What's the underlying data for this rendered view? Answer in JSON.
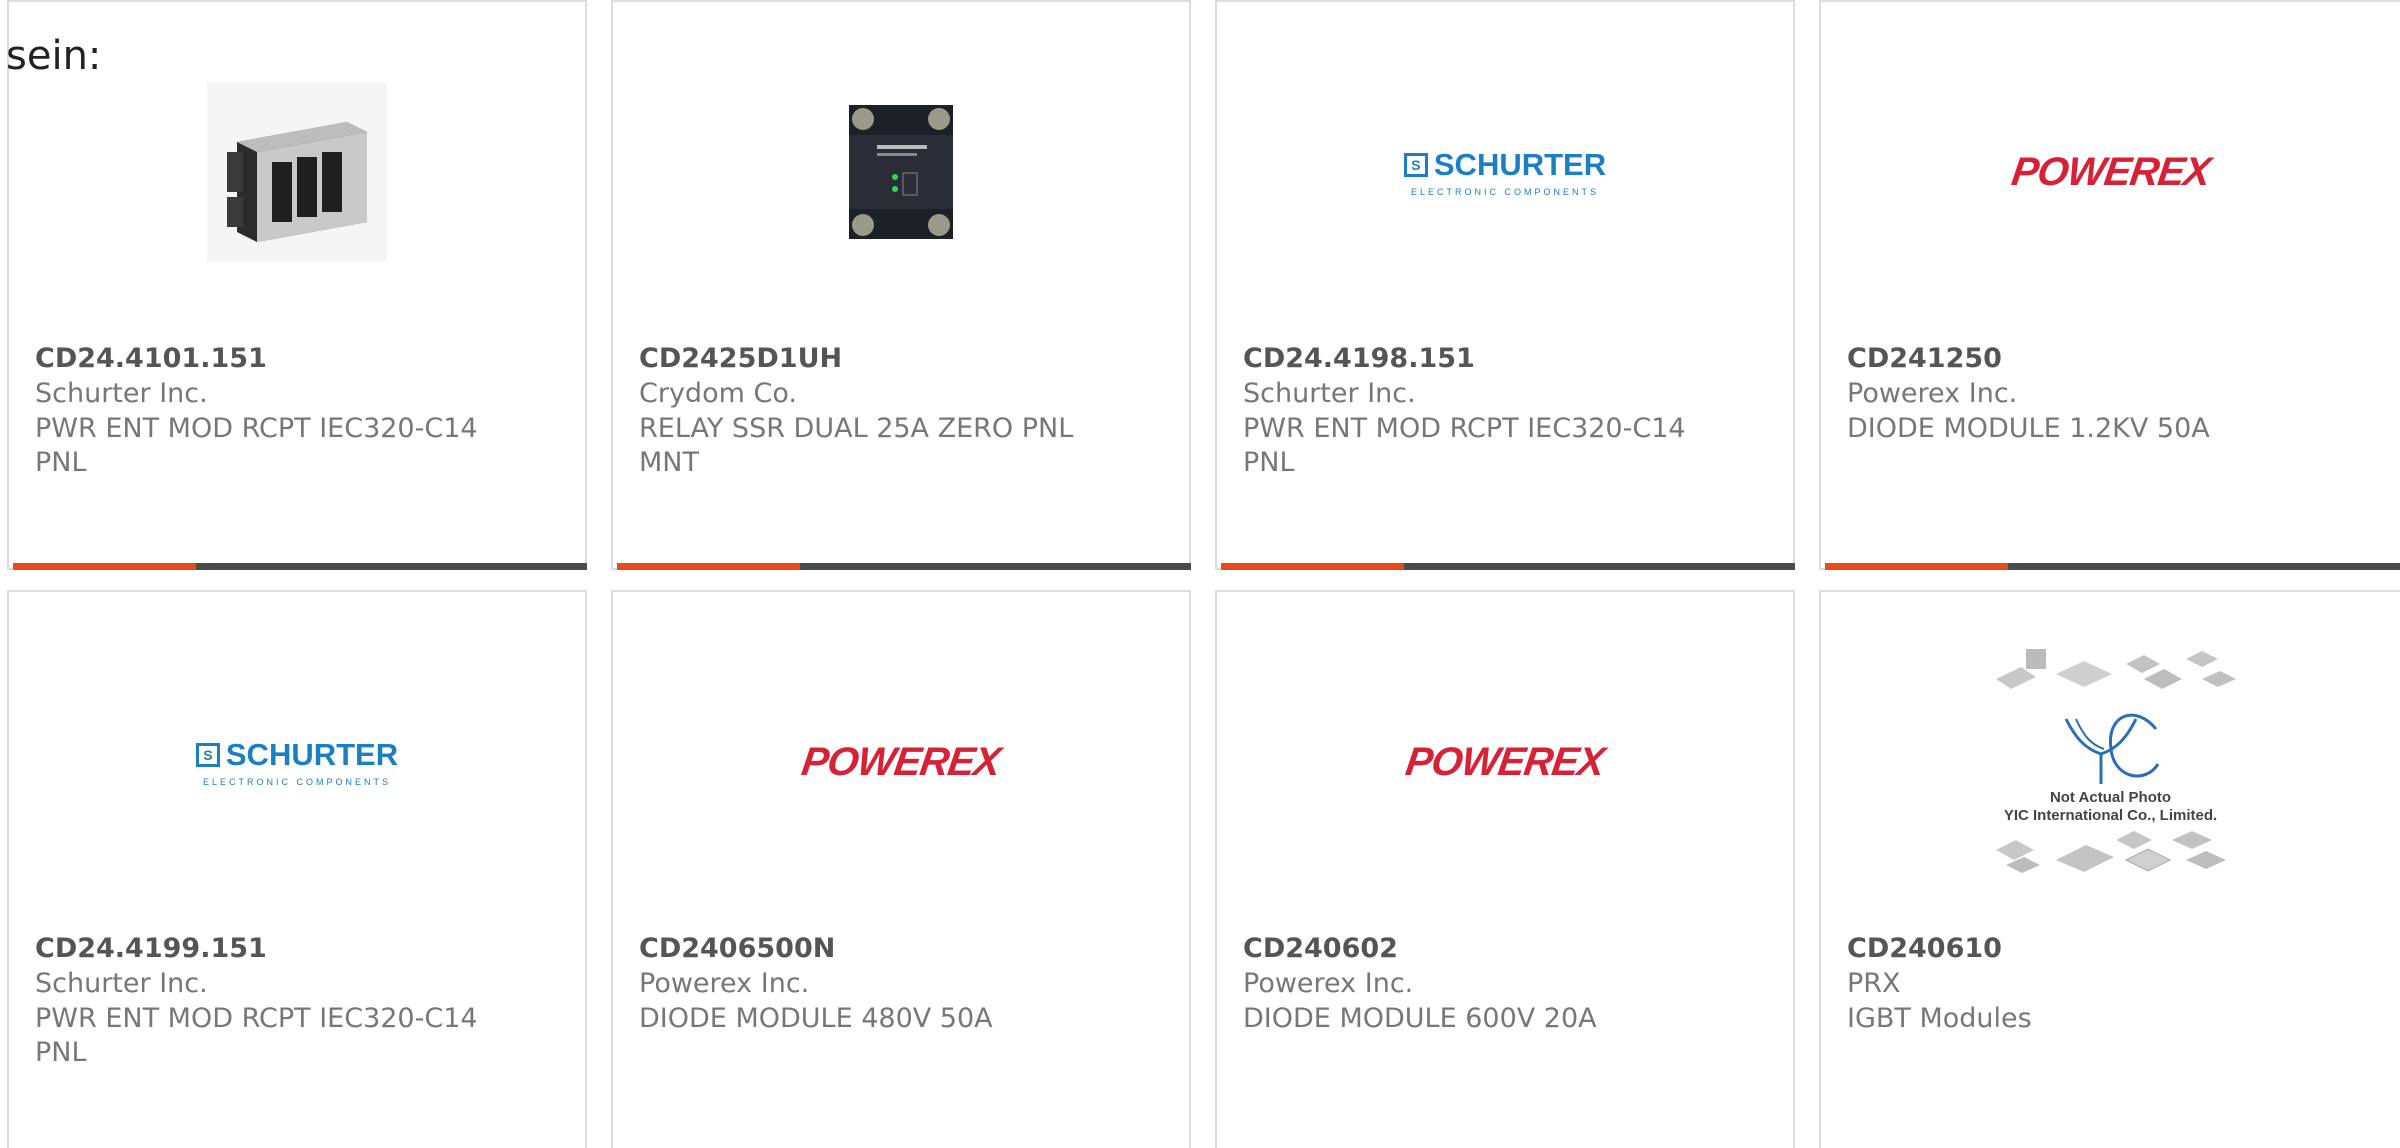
{
  "intro_text": "sein:",
  "colors": {
    "accent": "#e94a1c",
    "bar": "#4a4a4a",
    "schurter_blue": "#1b7fc4",
    "powerex_red": "#d62236"
  },
  "products": [
    {
      "part": "CD24.4101.151",
      "manufacturer": "Schurter Inc.",
      "description": "PWR ENT MOD RCPT IEC320-C14 PNL",
      "image": "power-entry-module-photo"
    },
    {
      "part": "CD2425D1UH",
      "manufacturer": "Crydom Co.",
      "description": "RELAY SSR DUAL 25A ZERO PNL MNT",
      "image": "solid-state-relay-photo"
    },
    {
      "part": "CD24.4198.151",
      "manufacturer": "Schurter Inc.",
      "description": "PWR ENT MOD RCPT IEC320-C14 PNL",
      "image": "schurter-logo"
    },
    {
      "part": "CD241250",
      "manufacturer": "Powerex Inc.",
      "description": "DIODE MODULE 1.2KV 50A",
      "image": "powerex-logo"
    },
    {
      "part": "CD24.4199.151",
      "manufacturer": "Schurter Inc.",
      "description": "PWR ENT MOD RCPT IEC320-C14 PNL",
      "image": "schurter-logo"
    },
    {
      "part": "CD2406500N",
      "manufacturer": "Powerex Inc.",
      "description": "DIODE MODULE 480V 50A",
      "image": "powerex-logo"
    },
    {
      "part": "CD240602",
      "manufacturer": "Powerex Inc.",
      "description": "DIODE MODULE 600V 20A",
      "image": "powerex-logo"
    },
    {
      "part": "CD240610",
      "manufacturer": "PRX",
      "description": "IGBT Modules",
      "image": "yic-placeholder"
    }
  ],
  "logos": {
    "schurter_box": "S",
    "schurter_name": "SCHURTER",
    "schurter_tagline": "ELECTRONIC COMPONENTS",
    "powerex_name": "POWEREX",
    "yic_note_1": "Not Actual Photo",
    "yic_note_2": "YIC International Co., Limited."
  }
}
